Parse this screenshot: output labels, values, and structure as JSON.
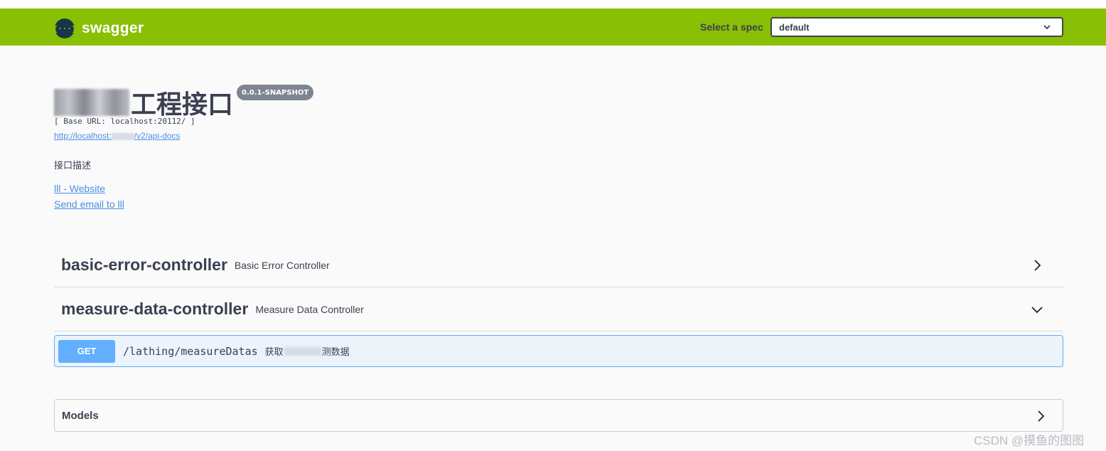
{
  "header": {
    "logo_glyph": "{···}",
    "logo_text": "swagger",
    "spec_label": "Select a spec",
    "spec_selected": "default"
  },
  "info": {
    "title_visible": "工程接口",
    "version": "0.0.1-SNAPSHOT",
    "base_url": "[ Base URL: localhost:20112/ ]",
    "api_docs_prefix": "http://localhost:",
    "api_docs_suffix": "/v2/api-docs",
    "description": "接口描述",
    "website_link": "lll - Website",
    "email_link": "Send email to lll"
  },
  "tags": [
    {
      "name": "basic-error-controller",
      "description": "Basic Error Controller",
      "expanded": false
    },
    {
      "name": "measure-data-controller",
      "description": "Measure Data Controller",
      "expanded": true
    }
  ],
  "operations": [
    {
      "method": "GET",
      "path": "/lathing/measureDatas",
      "summary_prefix": "获取",
      "summary_suffix": "测数据"
    }
  ],
  "models": {
    "title": "Models"
  },
  "watermark": "CSDN @摸鱼的图图",
  "colors": {
    "topbar": "#89bf04",
    "get": "#61affe",
    "get_bg": "#ebf3fb",
    "link": "#4990e2",
    "version_badge": "#7d8492"
  }
}
